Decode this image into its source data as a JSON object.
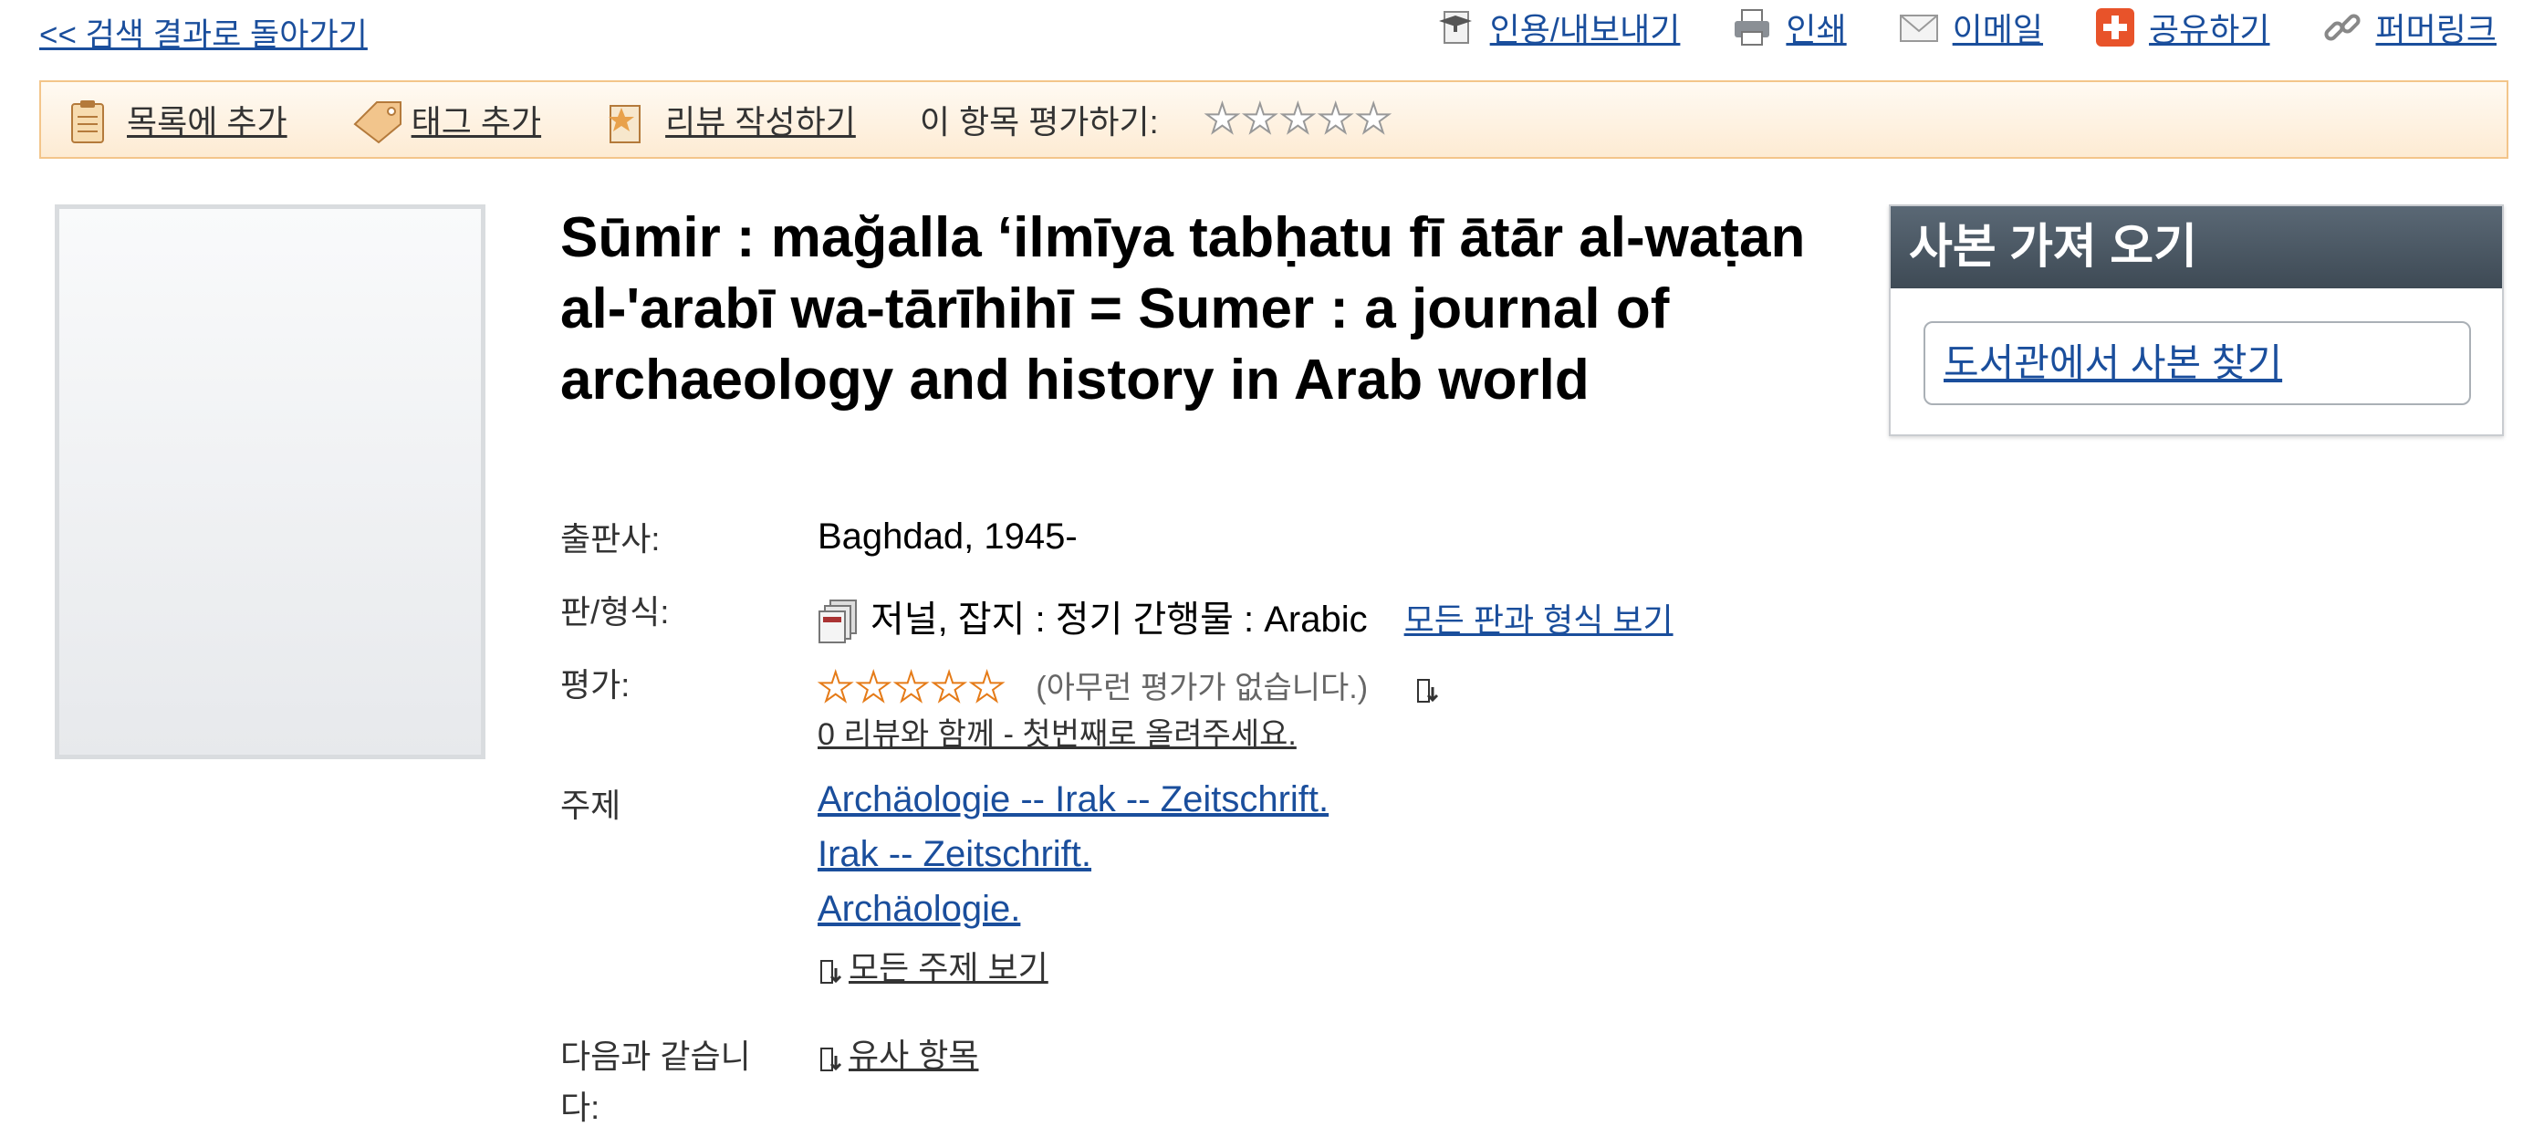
{
  "nav": {
    "back_label": "<< 검색 결과로 돌아가기"
  },
  "top_actions": [
    {
      "label": "인용/내보내기",
      "icon": "cite-export-icon"
    },
    {
      "label": "인쇄",
      "icon": "print-icon"
    },
    {
      "label": "이메일",
      "icon": "email-icon"
    },
    {
      "label": "공유하기",
      "icon": "share-icon"
    },
    {
      "label": "퍼머링크",
      "icon": "permalink-icon"
    }
  ],
  "toolbar": {
    "add_to_list": "목록에 추가",
    "add_tag": "태그 추가",
    "write_review": "리뷰 작성하기",
    "rate_label": "이 항목 평가하기:",
    "rating_stars": 0
  },
  "record": {
    "title": "Sūmir : mağalla ʻilmīya tabḥatu fī ātār al-waṭan al-'arabī wa-tārīhihī = Sumer : a journal of archaeology and history in Arab world",
    "publisher_label": "출판사:",
    "publisher_value": "Baghdad, 1945-",
    "format_label": "판/형식:",
    "format_value": "저널, 잡지 : 정기 간행물 : Arabic",
    "format_view_all": "모든 판과 형식 보기",
    "rating_label": "평가:",
    "rating_value": 0,
    "no_ratings": "(아무런 평가가 없습니다.)",
    "reviews_link": "0 리뷰와 함께 - 첫번째로 올려주세요.",
    "subjects_label": "주제",
    "subjects": [
      "Archäologie -- Irak -- Zeitschrift.",
      "Irak -- Zeitschrift.",
      "Archäologie."
    ],
    "view_all_subjects": "모든 주제 보기",
    "similar_label": "다음과 같습니다:",
    "similar_link": "유사 항목"
  },
  "get_copy": {
    "header": "사본 가져 오기",
    "find_button": "도서관에서 사본 찾기"
  },
  "colors": {
    "link": "#1a4e9c",
    "toolbar_bg": "#fdebd3",
    "toolbar_border": "#f3c58a",
    "panel_header": "#4a5661",
    "star_orange": "#e57b18"
  }
}
